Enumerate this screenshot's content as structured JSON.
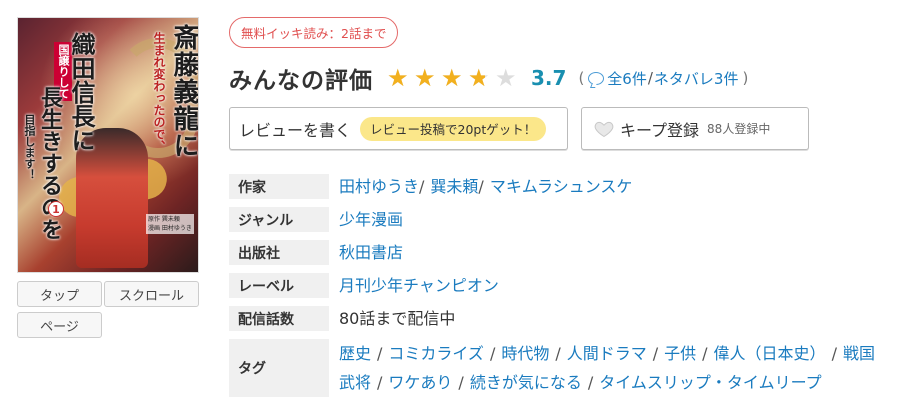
{
  "cover": {
    "title_line1": "斎藤義龍に",
    "title_line2": "生まれ変わったので、",
    "ribbon": "国譲りして",
    "title_line3": "織田信長に",
    "title_line4": "長生きするのを",
    "title_line5": "目指します！",
    "volume": "1",
    "credits": "原作 巽未頼\n漫画 田村ゆうき"
  },
  "cover_buttons": {
    "tap": "タップ",
    "scroll": "スクロール",
    "page": "ページ"
  },
  "free_badge": "無料イッキ読み：2話まで",
  "rating": {
    "title": "みんなの評価",
    "score": "3.7",
    "stars_value": 3.7,
    "stars_max": 5,
    "review_total": "全6件",
    "spoiler": "ネタバレ3件",
    "open_paren": "(",
    "close_paren": ")",
    "slash": "/"
  },
  "review_button": {
    "label": "レビューを書く",
    "bonus": "レビュー投稿で20ptゲット！"
  },
  "keep_button": {
    "label": "キープ登録",
    "count": "88人登録中"
  },
  "info": {
    "author_key": "作家",
    "authors": [
      "田村ゆうき",
      "巽未頼",
      "マキムラシュンスケ"
    ],
    "genre_key": "ジャンル",
    "genre": "少年漫画",
    "publisher_key": "出版社",
    "publisher": "秋田書店",
    "label_key": "レーベル",
    "label": "月刊少年チャンピオン",
    "episodes_key": "配信話数",
    "episodes": "80話まで配信中",
    "tags_key": "タグ",
    "tags": [
      "歴史",
      "コミカライズ",
      "時代物",
      "人間ドラマ",
      "子供",
      "偉人（日本史）",
      "戦国武将",
      "ワケあり",
      "続きが気になる",
      "タイムスリップ・タイムリープ"
    ]
  },
  "colors": {
    "accent_blue": "#198fb0",
    "link": "#1a7bbf",
    "star": "#f2b01e",
    "badge_red": "#e04e4e",
    "pill_yellow": "#fbe78a"
  }
}
